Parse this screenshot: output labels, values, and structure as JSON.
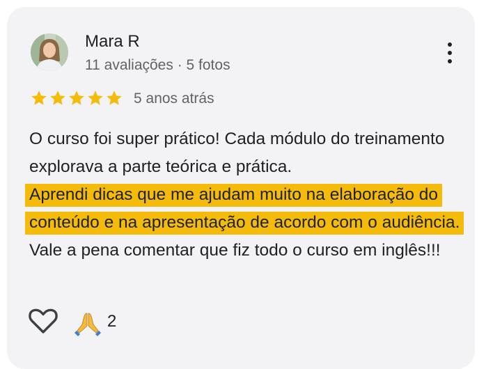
{
  "reviewer": {
    "name": "Mara R",
    "stats": "11 avaliações · 5 fotos"
  },
  "rating": {
    "stars": 5,
    "max": 5,
    "color": "#f5bb0b"
  },
  "time_ago": "5 anos atrás",
  "review": {
    "text_before": "O curso foi super prático! Cada módulo do treinamento explorava a parte teórica e prática.",
    "text_highlighted": "Aprendi dicas que me ajudam muito na elaboração do conteúdo e na apresentação de acordo com o audiência.",
    "text_after": "Vale a pena comentar que fiz todo o curso em inglês!!!",
    "highlight_color": "#f5bb0b"
  },
  "actions": {
    "like_icon": "heart-icon",
    "reaction_icon": "praying-hands-icon",
    "reaction_count": "2"
  },
  "menu_icon": "more-vert-icon"
}
